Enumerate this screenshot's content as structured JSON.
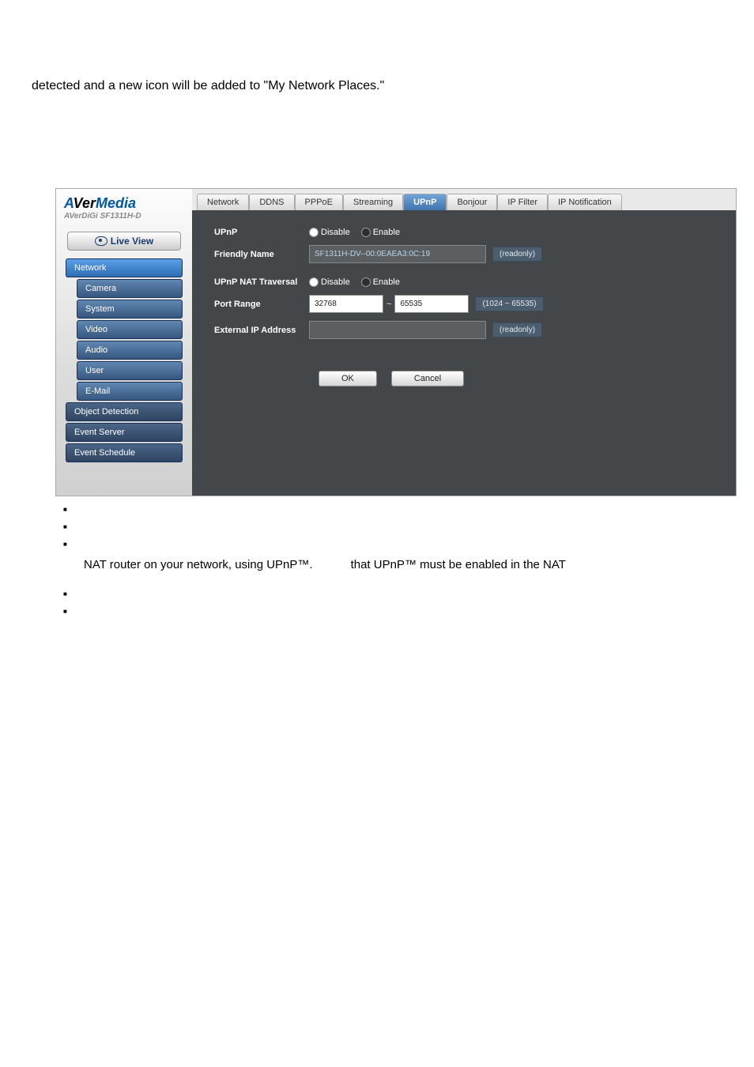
{
  "intro": "detected and a new icon will be added to \"My Network Places.\"",
  "logo": {
    "a": "A",
    "ver": "Ver",
    "media": "Media",
    "sub": "AVerDiGi SF1311H-D"
  },
  "liveView": "Live View",
  "sidebar": {
    "items": [
      {
        "label": "Network",
        "cls": "nav-item active"
      },
      {
        "label": "Camera",
        "cls": "nav-item sub"
      },
      {
        "label": "System",
        "cls": "nav-item sub"
      },
      {
        "label": "Video",
        "cls": "nav-item sub"
      },
      {
        "label": "Audio",
        "cls": "nav-item sub"
      },
      {
        "label": "User",
        "cls": "nav-item sub"
      },
      {
        "label": "E-Mail",
        "cls": "nav-item sub"
      },
      {
        "label": "Object Detection",
        "cls": "nav-item dark"
      },
      {
        "label": "Event Server",
        "cls": "nav-item dark"
      },
      {
        "label": "Event Schedule",
        "cls": "nav-item dark"
      }
    ]
  },
  "tabs": [
    {
      "label": "Network"
    },
    {
      "label": "DDNS"
    },
    {
      "label": "PPPoE"
    },
    {
      "label": "Streaming"
    },
    {
      "label": "UPnP",
      "active": true
    },
    {
      "label": "Bonjour"
    },
    {
      "label": "IP Filter"
    },
    {
      "label": "IP Notification"
    }
  ],
  "form": {
    "upnpLabel": "UPnP",
    "disable": "Disable",
    "enable": "Enable",
    "friendlyNameLabel": "Friendly Name",
    "friendlyNameValue": "SF1311H-DV--00:0EAEA3:0C:19",
    "readonly": "(readonly)",
    "natLabel": "UPnP NAT Traversal",
    "portRangeLabel": "Port Range",
    "portFrom": "32768",
    "portTo": "65535",
    "portHint": "(1024 ~ 65535)",
    "extIpLabel": "External IP Address",
    "extIpValue": ""
  },
  "buttons": {
    "ok": "OK",
    "cancel": "Cancel"
  },
  "belowText1": "NAT router on your network, using UPnP™.",
  "belowText2": "that UPnP™ must be enabled in the NAT"
}
